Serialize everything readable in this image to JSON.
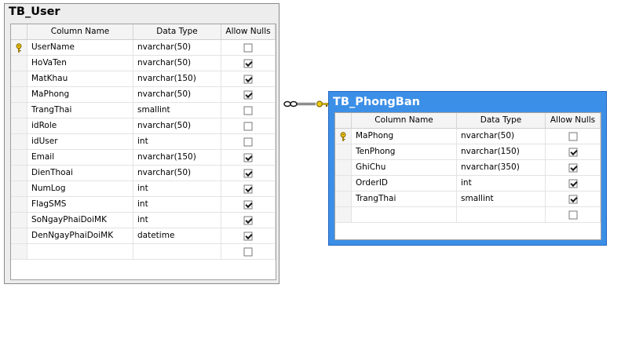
{
  "user_table": {
    "title": "TB_User",
    "headers": {
      "name": "Column Name",
      "type": "Data Type",
      "nulls": "Allow Nulls"
    },
    "rows": [
      {
        "name": "UserName",
        "type": "nvarchar(50)",
        "nullable": false,
        "key": true
      },
      {
        "name": "HoVaTen",
        "type": "nvarchar(50)",
        "nullable": true,
        "key": false
      },
      {
        "name": "MatKhau",
        "type": "nvarchar(150)",
        "nullable": true,
        "key": false
      },
      {
        "name": "MaPhong",
        "type": "nvarchar(50)",
        "nullable": true,
        "key": false
      },
      {
        "name": "TrangThai",
        "type": "smallint",
        "nullable": false,
        "key": false
      },
      {
        "name": "idRole",
        "type": "nvarchar(50)",
        "nullable": false,
        "key": false
      },
      {
        "name": "idUser",
        "type": "int",
        "nullable": false,
        "key": false
      },
      {
        "name": "Email",
        "type": "nvarchar(150)",
        "nullable": true,
        "key": false
      },
      {
        "name": "DienThoai",
        "type": "nvarchar(50)",
        "nullable": true,
        "key": false
      },
      {
        "name": "NumLog",
        "type": "int",
        "nullable": true,
        "key": false
      },
      {
        "name": "FlagSMS",
        "type": "int",
        "nullable": true,
        "key": false
      },
      {
        "name": "SoNgayPhaiDoiMK",
        "type": "int",
        "nullable": true,
        "key": false
      },
      {
        "name": "DenNgayPhaiDoiMK",
        "type": "datetime",
        "nullable": true,
        "key": false
      },
      {
        "name": "",
        "type": "",
        "nullable": false,
        "key": false
      }
    ]
  },
  "phongban_table": {
    "title": "TB_PhongBan",
    "headers": {
      "name": "Column Name",
      "type": "Data Type",
      "nulls": "Allow Nulls"
    },
    "rows": [
      {
        "name": "MaPhong",
        "type": "nvarchar(50)",
        "nullable": false,
        "key": true
      },
      {
        "name": "TenPhong",
        "type": "nvarchar(150)",
        "nullable": true,
        "key": false
      },
      {
        "name": "GhiChu",
        "type": "nvarchar(350)",
        "nullable": true,
        "key": false
      },
      {
        "name": "OrderID",
        "type": "int",
        "nullable": true,
        "key": false
      },
      {
        "name": "TrangThai",
        "type": "smallint",
        "nullable": true,
        "key": false
      },
      {
        "name": "",
        "type": "",
        "nullable": false,
        "key": false
      }
    ]
  },
  "colors": {
    "selected_header": "#3c8fe6",
    "relationship_key": "#e6c200"
  }
}
